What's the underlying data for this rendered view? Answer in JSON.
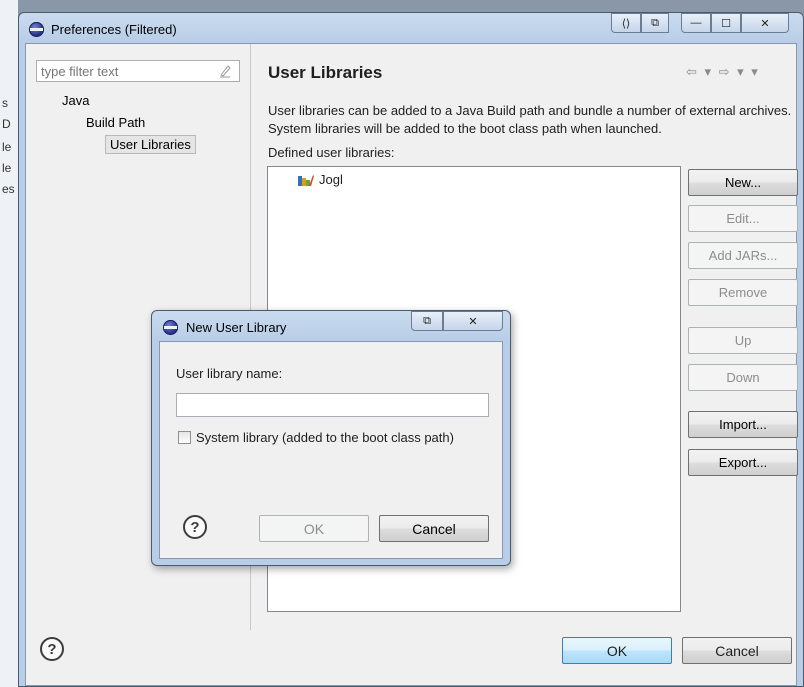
{
  "window": {
    "title": "Preferences (Filtered)",
    "controls": {
      "restore_dock": "⟨⟩",
      "copy": "⧉",
      "minimize": "—",
      "maximize": "☐",
      "close": "✕"
    }
  },
  "filter": {
    "placeholder": "type filter text"
  },
  "tree": {
    "items": [
      "Java",
      "Build Path",
      "User Libraries"
    ],
    "selected": "User Libraries"
  },
  "page": {
    "title": "User Libraries",
    "nav_arrows": "⇦ ▾ ⇨ ▾ ▾",
    "description": "User libraries can be added to a Java Build path and bundle a number of external archives. System libraries will be added to the boot class path when launched.",
    "list_label": "Defined user libraries:",
    "libraries": [
      "Jogl"
    ]
  },
  "side_buttons": {
    "new": "New...",
    "edit": "Edit...",
    "add_jars": "Add JARs...",
    "remove": "Remove",
    "up": "Up",
    "down": "Down",
    "import": "Import...",
    "export": "Export..."
  },
  "footer": {
    "ok": "OK",
    "cancel": "Cancel",
    "help": "?"
  },
  "dialog": {
    "title": "New User Library",
    "name_label": "User library name:",
    "name_value": "",
    "checkbox_label": "System library (added to the boot class path)",
    "ok": "OK",
    "cancel": "Cancel",
    "help": "?"
  },
  "background_strip": [
    "s",
    "D",
    "le",
    "le",
    "es"
  ]
}
